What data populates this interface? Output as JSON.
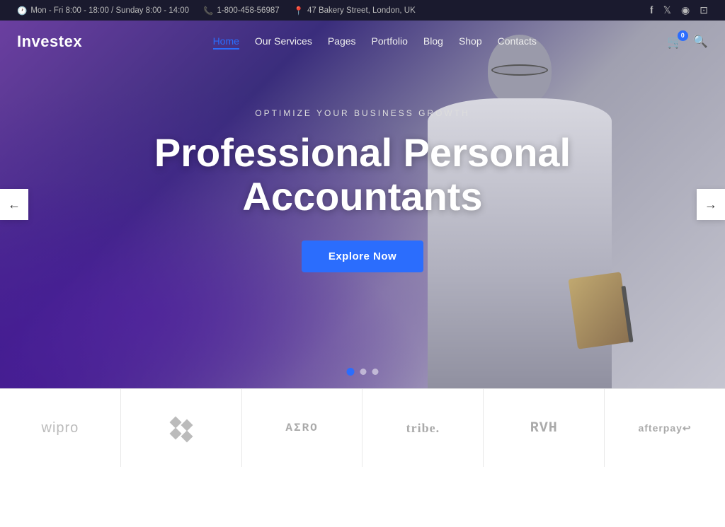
{
  "topbar": {
    "hours": "Mon - Fri 8:00 - 18:00 / Sunday 8:00 - 14:00",
    "phone": "1-800-458-56987",
    "address": "47 Bakery Street, London, UK",
    "social": [
      "facebook-icon",
      "twitter-icon",
      "globe-icon",
      "instagram-icon"
    ]
  },
  "nav": {
    "logo": "Investex",
    "links": [
      {
        "label": "Home",
        "active": true
      },
      {
        "label": "Our Services",
        "active": false
      },
      {
        "label": "Pages",
        "active": false
      },
      {
        "label": "Portfolio",
        "active": false
      },
      {
        "label": "Blog",
        "active": false
      },
      {
        "label": "Shop",
        "active": false
      },
      {
        "label": "Contacts",
        "active": false
      }
    ],
    "cart_count": "0"
  },
  "hero": {
    "subtitle": "Optimize Your Business Growth",
    "title": "Professional Personal Accountants",
    "cta_label": "Explore Now",
    "dots": [
      {
        "active": true
      },
      {
        "active": false
      },
      {
        "active": false
      }
    ],
    "arrow_left": "←",
    "arrow_right": "→"
  },
  "partners": [
    {
      "name": "wipro",
      "type": "text",
      "label": "wipro"
    },
    {
      "name": "diamonds",
      "type": "diamonds",
      "label": ""
    },
    {
      "name": "aero",
      "type": "text",
      "label": "AΣRO"
    },
    {
      "name": "tribe",
      "type": "text",
      "label": "tribe."
    },
    {
      "name": "rmh",
      "type": "text",
      "label": "RMH"
    },
    {
      "name": "afterpay",
      "type": "text",
      "label": "afterpay↩"
    }
  ]
}
